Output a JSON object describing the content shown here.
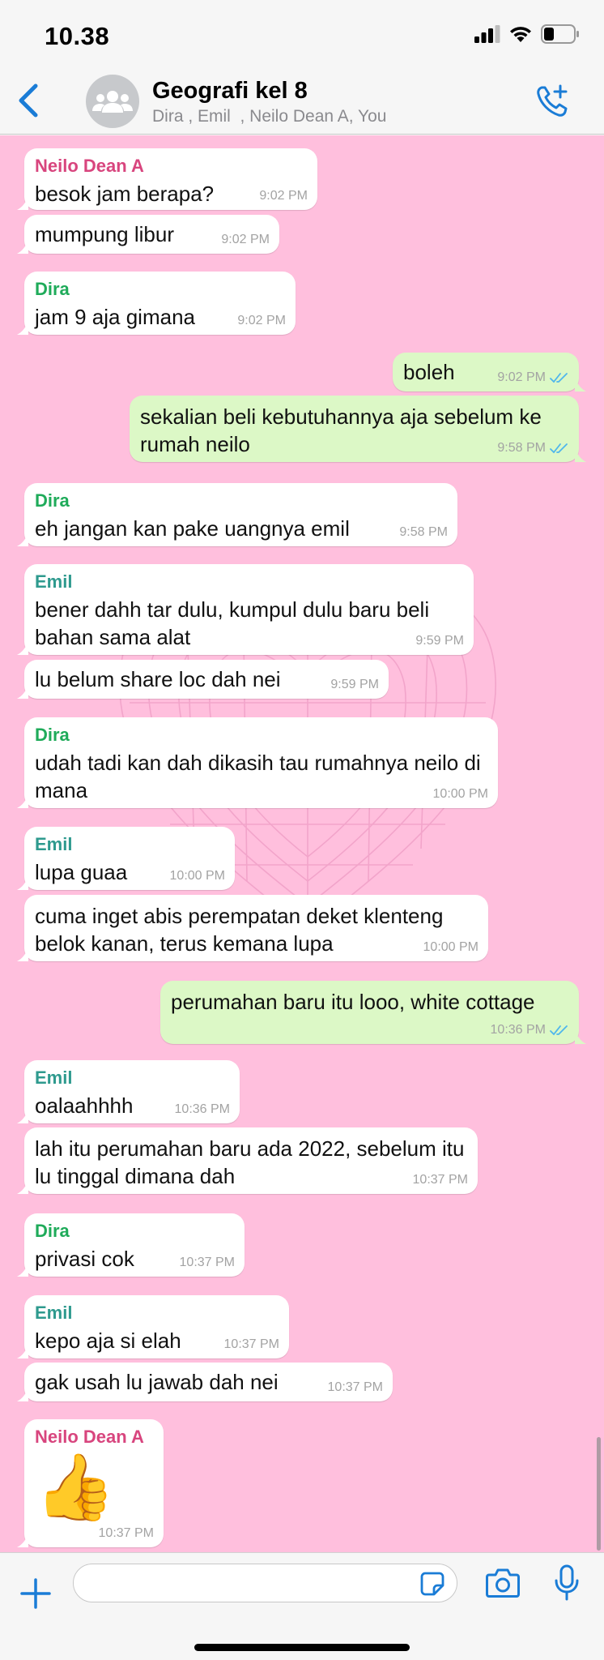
{
  "status_bar": {
    "time": "10.38"
  },
  "header": {
    "title": "Geografi kel 8",
    "subtitle": "Dira , Emil  , Neilo Dean A, You"
  },
  "colors": {
    "chat_background": "#ffbfdd",
    "incoming_bubble": "#ffffff",
    "outgoing_bubble": "#dcf8c6",
    "accent_blue": "#1a7cd6",
    "sender_neilo": "#d8457e",
    "sender_dira": "#1fab5a",
    "sender_emil": "#2e9a8e"
  },
  "messages": [
    {
      "sender": "Neilo Dean A",
      "text": "besok jam berapa?",
      "time": "9:02 PM"
    },
    {
      "text": "mumpung libur",
      "time": "9:02 PM"
    },
    {
      "sender": "Dira",
      "text": "jam 9 aja gimana",
      "time": "9:02 PM"
    },
    {
      "text": "boleh",
      "time": "9:02 PM"
    },
    {
      "text": "sekalian beli kebutuhannya aja sebelum ke rumah neilo",
      "time": "9:58 PM"
    },
    {
      "sender": "Dira",
      "text": "eh jangan kan pake uangnya emil",
      "time": "9:58 PM"
    },
    {
      "sender": "Emil",
      "text": "bener dahh tar dulu, kumpul dulu baru beli bahan sama alat",
      "time": "9:59 PM"
    },
    {
      "text": "lu belum share loc dah nei",
      "time": "9:59 PM"
    },
    {
      "sender": "Dira",
      "text": "udah tadi kan dah dikasih tau rumahnya neilo di mana",
      "time": "10:00 PM"
    },
    {
      "sender": "Emil",
      "text": "lupa guaa",
      "time": "10:00 PM"
    },
    {
      "text": "cuma inget abis perempatan deket klenteng belok kanan, terus kemana lupa",
      "time": "10:00 PM"
    },
    {
      "text": "perumahan baru itu looo, white cottage",
      "time": "10:36 PM"
    },
    {
      "sender": "Emil",
      "text": "oalaahhhh",
      "time": "10:36 PM"
    },
    {
      "text": "lah itu perumahan baru ada 2022, sebelum itu lu tinggal dimana dah",
      "time": "10:37 PM"
    },
    {
      "sender": "Dira",
      "text": "privasi cok",
      "time": "10:37 PM"
    },
    {
      "sender": "Emil",
      "text": "kepo aja si elah",
      "time": "10:37 PM"
    },
    {
      "text": "gak usah lu jawab dah nei",
      "time": "10:37 PM"
    },
    {
      "sender": "Neilo Dean A",
      "text": "👍",
      "time": "10:37 PM"
    }
  ],
  "composer": {
    "value": "",
    "placeholder": ""
  },
  "icons": {
    "back": "chevron-left-icon",
    "avatar": "group-icon",
    "call": "add-call-icon",
    "plus": "plus-icon",
    "sticker": "sticker-icon",
    "camera": "camera-icon",
    "mic": "microphone-icon",
    "read_receipt": "double-check-icon"
  }
}
